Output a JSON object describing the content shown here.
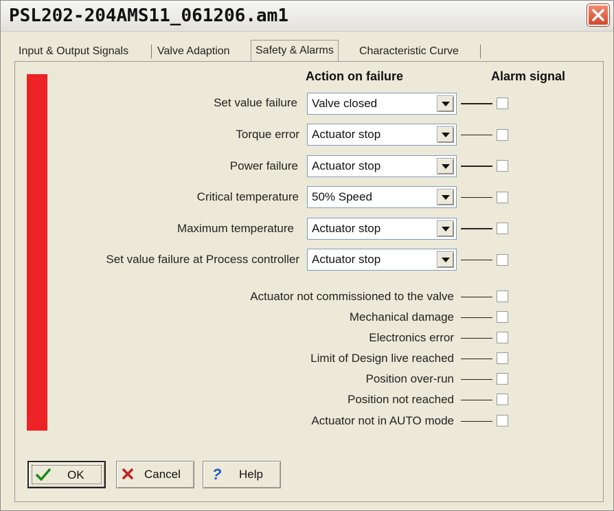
{
  "window": {
    "title": "PSL202-204AMS11_061206.am1"
  },
  "tabs": [
    {
      "label": "Input & Output Signals",
      "active": false
    },
    {
      "label": "Valve Adaption",
      "active": false
    },
    {
      "label": "Safety & Alarms",
      "active": true
    },
    {
      "label": "Characteristic Curve",
      "active": false
    }
  ],
  "headers": {
    "action": "Action on failure",
    "alarm": "Alarm signal"
  },
  "failure_rows": [
    {
      "label": "Set value failure",
      "value": "Valve closed",
      "alarm": false
    },
    {
      "label": "Torque error",
      "value": "Actuator stop",
      "alarm": false
    },
    {
      "label": "Power failure",
      "value": "Actuator stop",
      "alarm": false
    },
    {
      "label": "Critical temperature",
      "value": "50% Speed",
      "alarm": false
    },
    {
      "label": "Maximum temperature",
      "value": "Actuator stop",
      "alarm": false
    },
    {
      "label": "Set value failure at Process controller",
      "value": "Actuator stop",
      "alarm": false
    }
  ],
  "alarm_rows": [
    {
      "label": "Actuator not commissioned to the valve",
      "alarm": false
    },
    {
      "label": "Mechanical damage",
      "alarm": false
    },
    {
      "label": "Electronics error",
      "alarm": false
    },
    {
      "label": "Limit of Design live reached",
      "alarm": false
    },
    {
      "label": "Position over-run",
      "alarm": false
    },
    {
      "label": "Position not reached",
      "alarm": false
    },
    {
      "label": "Actuator not in AUTO mode",
      "alarm": false
    }
  ],
  "buttons": {
    "ok": "OK",
    "cancel": "Cancel",
    "help": "Help"
  },
  "colors": {
    "status_bar": "#ed2224",
    "close_button": "#d2472a"
  }
}
